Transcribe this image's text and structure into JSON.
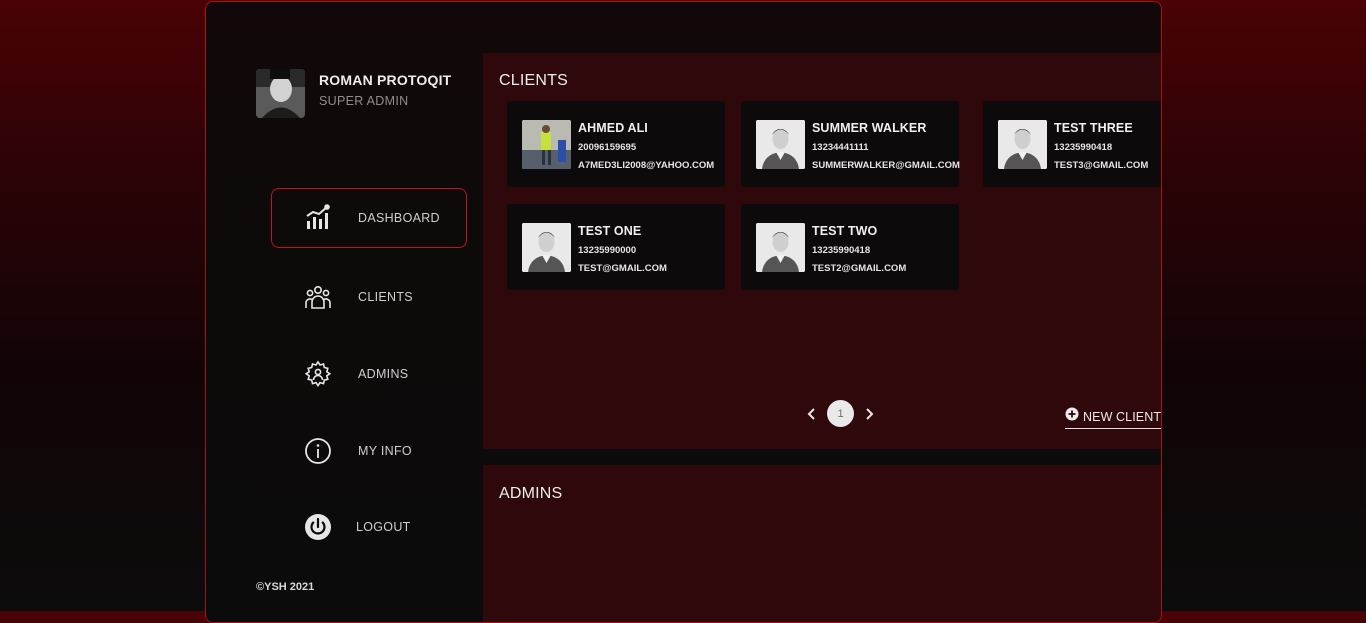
{
  "profile": {
    "name": "ROMAN PROTOQIT",
    "role": "SUPER ADMIN",
    "icon": "avatar"
  },
  "nav": [
    {
      "label": "DASHBOARD",
      "icon": "chart-icon",
      "active": true
    },
    {
      "label": "CLIENTS",
      "icon": "users-icon",
      "active": false
    },
    {
      "label": "ADMINS",
      "icon": "gear-user-icon",
      "active": false
    },
    {
      "label": "MY INFO",
      "icon": "info-icon",
      "active": false
    },
    {
      "label": "LOGOUT",
      "icon": "power-icon",
      "active": false
    }
  ],
  "footer": {
    "copyright": "©YSH 2021"
  },
  "clients": {
    "title": "CLIENTS",
    "items": [
      {
        "name": "AHMED ALI",
        "phone": "20096159695",
        "email": "A7MED3LI2008@YAHOO.COM"
      },
      {
        "name": "SUMMER WALKER",
        "phone": "13234441111",
        "email": "SUMMERWALKER@GMAIL.COM"
      },
      {
        "name": "TEST THREE",
        "phone": "13235990418",
        "email": "TEST3@GMAIL.COM"
      },
      {
        "name": "TEST ONE",
        "phone": "13235990000",
        "email": "TEST@GMAIL.COM"
      },
      {
        "name": "TEST TWO",
        "phone": "13235990418",
        "email": "TEST2@GMAIL.COM"
      }
    ],
    "pagination": {
      "current_page": "1"
    },
    "new_client_label": "NEW CLIENT"
  },
  "admins": {
    "title": "ADMINS"
  },
  "colors": {
    "accent": "#c4121b",
    "panel": "#2e080b",
    "card": "#0c0a0b"
  }
}
